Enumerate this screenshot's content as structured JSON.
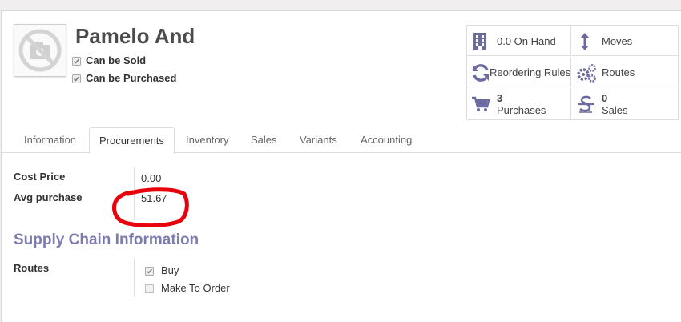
{
  "product": {
    "name": "Pamelo And",
    "can_be_sold_label": "Can be Sold",
    "can_be_purchased_label": "Can be Purchased",
    "avatar_icon": "no-image-camera-icon"
  },
  "stats": [
    {
      "label": "0.0 On Hand",
      "icon": "warehouse-icon"
    },
    {
      "label": "Moves",
      "icon": "arrows-vertical-icon"
    },
    {
      "label": "Reordering Rules",
      "icon": "refresh-icon"
    },
    {
      "label": "Routes",
      "icon": "cogs-icon"
    },
    {
      "count": "3",
      "label": "Purchases",
      "icon": "cart-icon"
    },
    {
      "count": "0",
      "label": "Sales",
      "icon": "strikethrough-dollar-icon"
    }
  ],
  "tabs": [
    "Information",
    "Procurements",
    "Inventory",
    "Sales",
    "Variants",
    "Accounting"
  ],
  "active_tab": "Procurements",
  "fields": {
    "cost_price_label": "Cost Price",
    "cost_price_value": "0.00",
    "avg_purchase_label": "Avg purchase",
    "avg_purchase_value": "51.67"
  },
  "supply_chain": {
    "title": "Supply Chain Information",
    "routes_label": "Routes",
    "routes": [
      {
        "label": "Buy",
        "checked": true
      },
      {
        "label": "Make To Order",
        "checked": false
      }
    ]
  },
  "colors": {
    "accent": "#7c7bad",
    "annotation": "#e8000c"
  }
}
